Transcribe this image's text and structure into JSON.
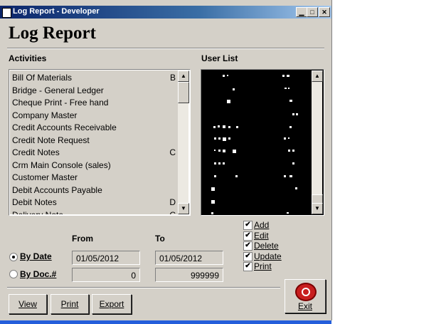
{
  "window": {
    "title": "Log Report - Developer",
    "controls": {
      "minimize": "▁",
      "maximize": "□",
      "close": "✕"
    }
  },
  "heading": "Log Report",
  "activities": {
    "label": "Activities",
    "items": [
      {
        "label": "Bill Of Materials",
        "key": "B"
      },
      {
        "label": "Bridge - General Ledger",
        "key": ""
      },
      {
        "label": "Cheque Print - Free hand",
        "key": ""
      },
      {
        "label": "Company Master",
        "key": ""
      },
      {
        "label": "Credit Accounts Receivable",
        "key": ""
      },
      {
        "label": "Credit Note Request",
        "key": ""
      },
      {
        "label": "Credit Notes",
        "key": "C"
      },
      {
        "label": "Crm Main Console (sales)",
        "key": ""
      },
      {
        "label": "Customer Master",
        "key": ""
      },
      {
        "label": "Debit Accounts Payable",
        "key": ""
      },
      {
        "label": "Debit Notes",
        "key": "D"
      },
      {
        "label": "Delivery Note",
        "key": "C"
      }
    ]
  },
  "user_list": {
    "label": "User List"
  },
  "filter": {
    "from_label": "From",
    "to_label": "To",
    "by_date": {
      "label": "By Date",
      "selected": true,
      "from": "01/05/2012",
      "to": "01/05/2012"
    },
    "by_doc": {
      "label": "By Doc.#",
      "selected": false,
      "from": "0",
      "to": "999999"
    }
  },
  "checkboxes": [
    {
      "label": "Add",
      "checked": true
    },
    {
      "label": "Edit",
      "checked": true
    },
    {
      "label": "Delete",
      "checked": true
    },
    {
      "label": "Update",
      "checked": true
    },
    {
      "label": "Print",
      "checked": true
    }
  ],
  "buttons": {
    "view": "View",
    "print": "Print",
    "export": "Export",
    "exit": "Exit"
  },
  "icons": {
    "window": "app-icon",
    "exit": "exit-lifebuoy-icon",
    "check": "✔"
  },
  "colors": {
    "window_bg": "#d4d0c8",
    "titlebar": "#0a246a",
    "list_bg": "#000000",
    "exit_icon": "#c81e1e"
  }
}
